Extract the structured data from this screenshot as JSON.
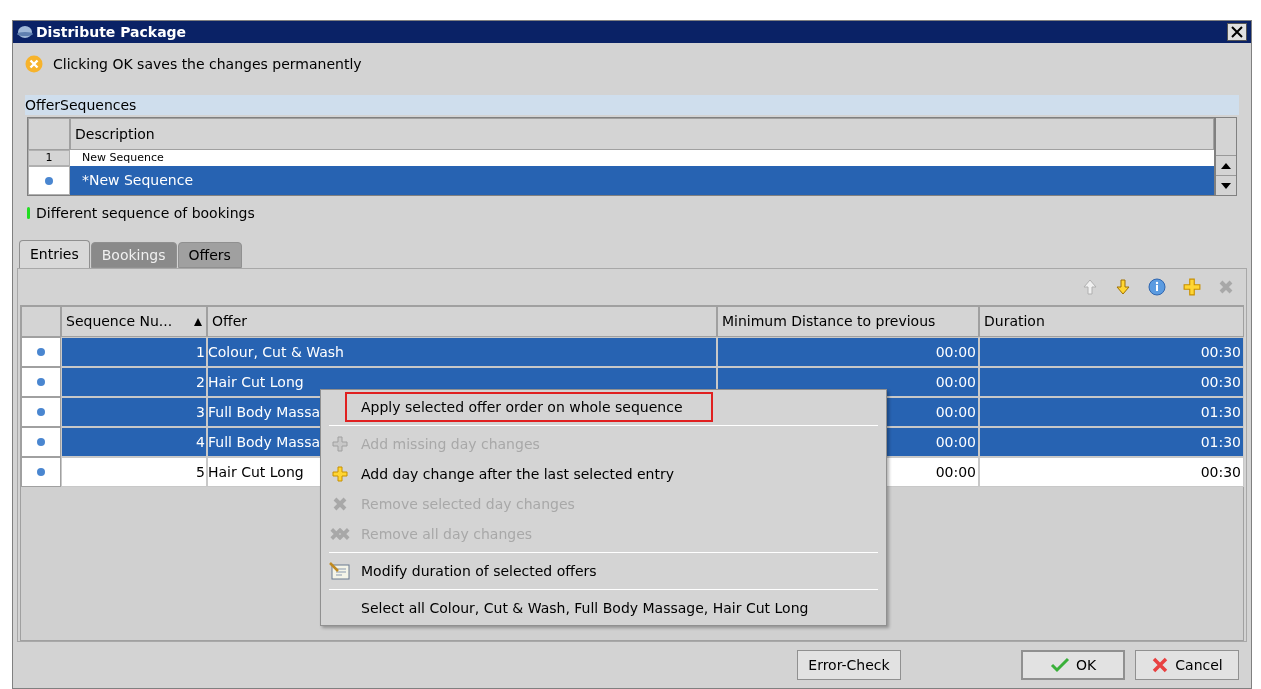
{
  "window": {
    "title": "Distribute Package"
  },
  "notice": "Clicking OK saves the changes permanently",
  "sequences": {
    "title": "OfferSequences",
    "columns": [
      "Description"
    ],
    "rows": [
      {
        "number": "1",
        "description": "New Sequence",
        "selected": false
      },
      {
        "description": "*New Sequence",
        "selected": true
      }
    ]
  },
  "warning": "Different sequence of bookings",
  "tabs": [
    {
      "label": "Entries",
      "selected": true,
      "disabled": false
    },
    {
      "label": "Bookings",
      "selected": false,
      "disabled": true
    },
    {
      "label": "Offers",
      "selected": false,
      "disabled": false
    }
  ],
  "toolbar": [
    {
      "kind": "up",
      "disabled": true
    },
    {
      "kind": "down",
      "disabled": false
    },
    {
      "kind": "info",
      "disabled": false
    },
    {
      "kind": "add",
      "disabled": false
    },
    {
      "kind": "remove",
      "disabled": true
    }
  ],
  "table": {
    "columns": [
      "Sequence Nu...",
      "Offer",
      "Minimum Distance to previous",
      "Duration"
    ],
    "rows": [
      {
        "seq": "1",
        "offer": "Colour, Cut & Wash",
        "distance": "00:00",
        "duration": "00:30",
        "selected": true
      },
      {
        "seq": "2",
        "offer": "Hair Cut Long",
        "distance": "00:00",
        "duration": "00:30",
        "selected": true
      },
      {
        "seq": "3",
        "offer": "Full Body Massa",
        "distance": "00:00",
        "duration": "01:30",
        "selected": true
      },
      {
        "seq": "4",
        "offer": "Full Body Massa",
        "distance": "00:00",
        "duration": "01:30",
        "selected": true
      },
      {
        "seq": "5",
        "offer": "Hair Cut Long",
        "distance": "00:00",
        "duration": "00:30",
        "selected": false
      }
    ]
  },
  "context_menu": [
    {
      "kind": "plain",
      "label": "Apply selected offer order on whole sequence",
      "disabled": false,
      "highlighted": true
    },
    {
      "kind": "separator"
    },
    {
      "kind": "add",
      "label": "Add missing day changes",
      "disabled": true,
      "highlighted": false
    },
    {
      "kind": "add",
      "label": "Add day change after the last selected entry",
      "disabled": false,
      "highlighted": false
    },
    {
      "kind": "remove",
      "label": "Remove selected day changes",
      "disabled": true,
      "highlighted": false
    },
    {
      "kind": "removeall",
      "label": "Remove all day changes",
      "disabled": true,
      "highlighted": false
    },
    {
      "kind": "separator"
    },
    {
      "kind": "modify",
      "label": "Modify duration of selected offers",
      "disabled": false,
      "highlighted": false
    },
    {
      "kind": "separator"
    },
    {
      "kind": "plain",
      "label": "Select all Colour, Cut & Wash, Full Body Massage, Hair Cut Long",
      "disabled": false,
      "highlighted": false
    }
  ],
  "buttons": [
    {
      "kind": "check",
      "label": "Error-Check"
    },
    {
      "kind": "ok",
      "label": "OK"
    },
    {
      "kind": "cancel",
      "label": "Cancel"
    }
  ]
}
